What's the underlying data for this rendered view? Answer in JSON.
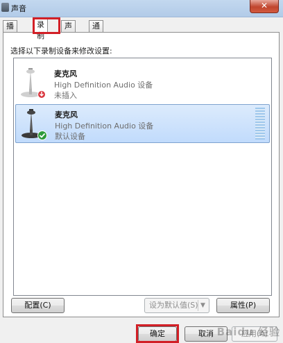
{
  "window": {
    "title": "声音",
    "close_symbol": "✕"
  },
  "tabs": [
    {
      "label": "播放",
      "active": false
    },
    {
      "label": "录制",
      "active": true
    },
    {
      "label": "声音",
      "active": false
    },
    {
      "label": "通信",
      "active": false
    }
  ],
  "panel": {
    "instructions": "选择以下录制设备来修改设置:"
  },
  "devices": [
    {
      "name": "麦克风",
      "description": "High Definition Audio 设备",
      "status": "未插入",
      "status_icon": "red-down-arrow",
      "selected": false
    },
    {
      "name": "麦克风",
      "description": "High Definition Audio 设备",
      "status": "默认设备",
      "status_icon": "green-check",
      "selected": true
    }
  ],
  "buttons": {
    "configure": "配置(C)",
    "set_default": "设为默认值(S)",
    "properties": "属性(P)",
    "ok": "确定",
    "cancel": "取消",
    "apply": "应用(A)"
  },
  "watermark": "Baidu 经验",
  "colors": {
    "highlight": "#d21f26",
    "selection": "#c1dbfc",
    "title_bar": "#b2cbe8"
  }
}
